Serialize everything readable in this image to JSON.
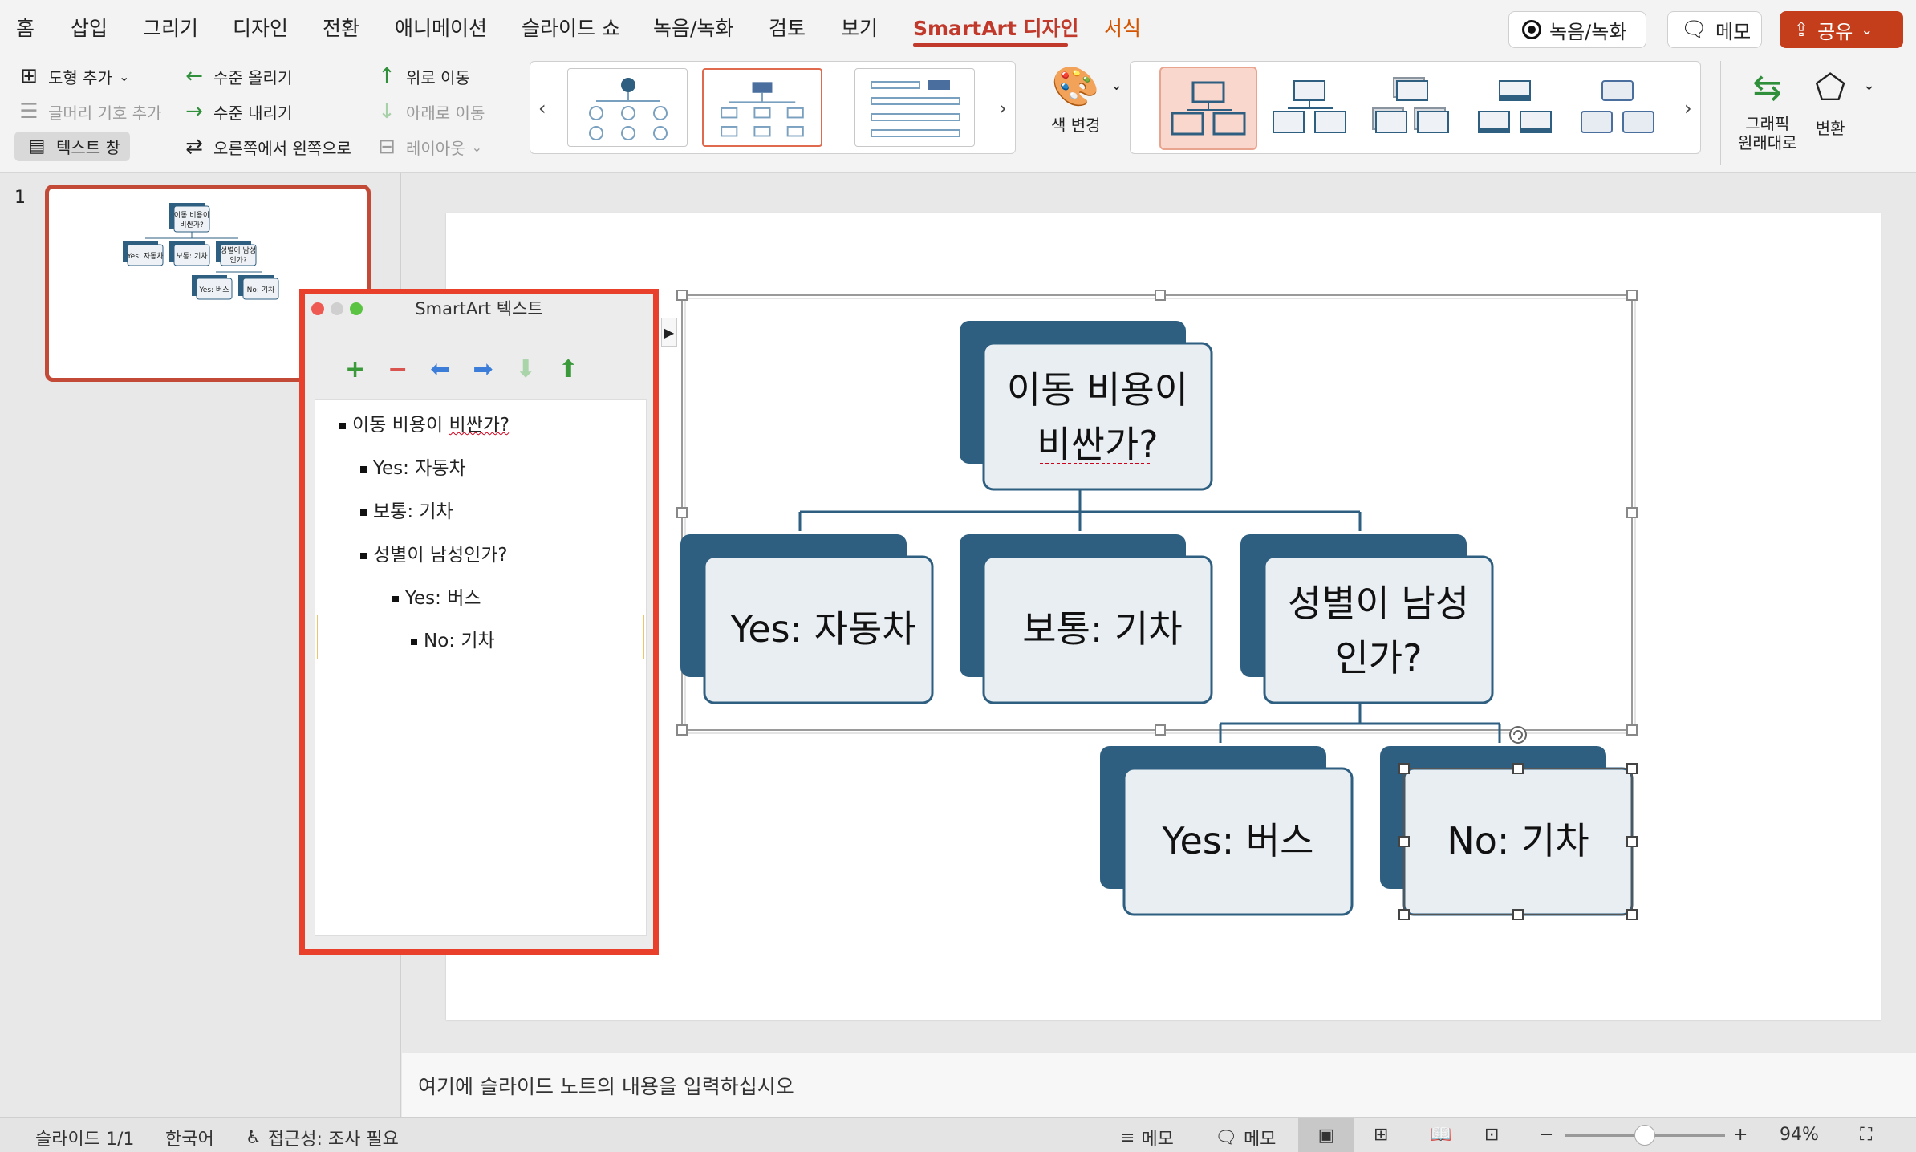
{
  "tabs": [
    "홈",
    "삽입",
    "그리기",
    "디자인",
    "전환",
    "애니메이션",
    "슬라이드 쇼",
    "녹음/녹화",
    "검토",
    "보기",
    "SmartArt 디자인",
    "서식"
  ],
  "active_tab": "SmartArt 디자인",
  "top_buttons": {
    "record": "녹음/녹화",
    "comment": "메모",
    "share": "공유"
  },
  "ribbon": {
    "add_shape": "도형 추가",
    "add_bullet": "글머리 기호 추가",
    "text_pane": "텍스트 창",
    "promote": "수준 올리기",
    "demote": "수준 내리기",
    "right_to_left": "오른쪽에서 왼쪽으로",
    "move_up": "위로 이동",
    "move_down": "아래로 이동",
    "layout": "레이아웃",
    "change_colors": "색 변경",
    "convert_to_shapes": "그래픽\n원래대로",
    "convert": "변환"
  },
  "slide_number": "1",
  "smartart_pane": {
    "title": "SmartArt 텍스트",
    "items": [
      {
        "level": 1,
        "text": "이동 비용이 비싼가?"
      },
      {
        "level": 2,
        "text": "Yes: 자동차"
      },
      {
        "level": 2,
        "text": "보통: 기차"
      },
      {
        "level": 2,
        "text": "성별이 남성인가?"
      },
      {
        "level": 3,
        "text": "Yes: 버스"
      },
      {
        "level": 3,
        "text": "No: 기차"
      }
    ]
  },
  "diagram": {
    "root_line1": "이동 비용이",
    "root_line2": "비싼가?",
    "child1": "Yes: 자동차",
    "child2": "보통: 기차",
    "child3_line1": "성별이 남성",
    "child3_line2": "인가?",
    "grand1": "Yes: 버스",
    "grand2": "No: 기차"
  },
  "thumbnail": {
    "root_line1": "이동 비용이",
    "root_line2": "비싼가?",
    "child1": "Yes: 자동차",
    "child2": "보통: 기차",
    "child3_line1": "성별이 남성",
    "child3_line2": "인가?",
    "grand1": "Yes: 버스",
    "grand2": "No: 기차"
  },
  "notes_placeholder": "여기에 슬라이드 노트의 내용을 입력하십시오",
  "status": {
    "slide": "슬라이드 1/1",
    "language": "한국어",
    "accessibility": "접근성: 조사 필요",
    "notes": "메모",
    "comments": "메모",
    "zoom": "94%"
  },
  "zoom_value": 0.5,
  "colors": {
    "accent": "#c0392b",
    "shape_dark": "#2e5f80",
    "shape_light": "#e9eef3",
    "pane_border": "#e8402b"
  }
}
